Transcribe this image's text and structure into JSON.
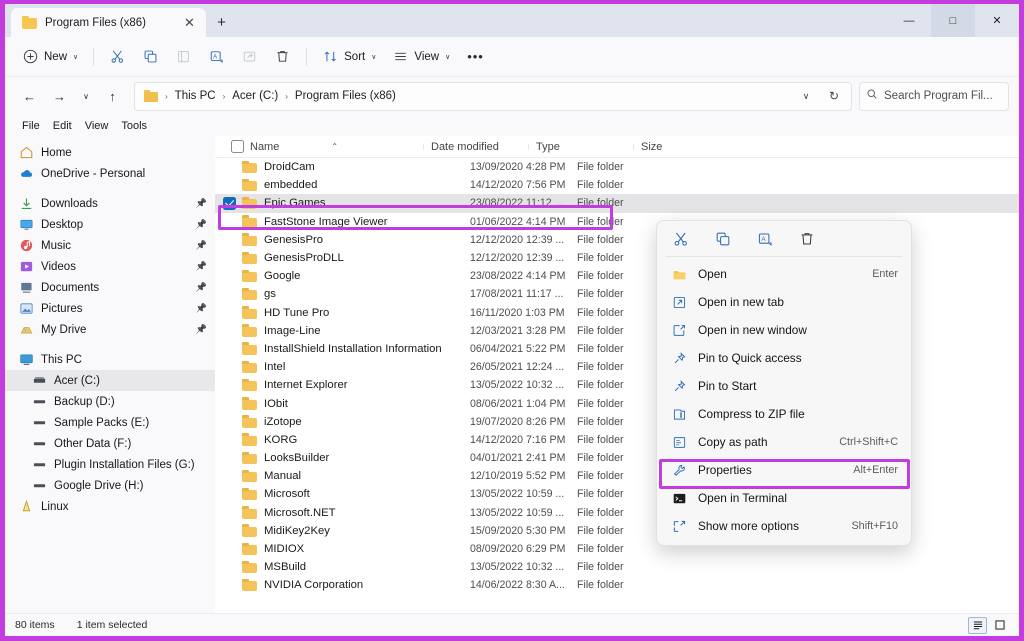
{
  "window": {
    "tab_title": "Program Files (x86)",
    "new_tab_label": "+",
    "close_tab_label": "✕",
    "minimize_label": "—",
    "maximize_label": "□",
    "close_label": "✕",
    "accent_purple": "#c23ce0"
  },
  "toolbar": {
    "new_label": "New",
    "new_chevron": "∨",
    "cut_icon": "scissors-icon",
    "copy_icon": "copy-icon",
    "paste_icon": "paste-icon",
    "rename_icon": "rename-icon",
    "share_icon": "share-icon",
    "delete_icon": "trash-icon",
    "sort_label": "Sort",
    "sort_chevron": "∨",
    "view_label": "View",
    "view_chevron": "∨",
    "more_label": "•••"
  },
  "address": {
    "back_label": "←",
    "forward_label": "→",
    "recent_label": "∨",
    "up_label": "↑",
    "crumbs": [
      "This PC",
      "Acer (C:)",
      "Program Files (x86)"
    ],
    "crumb_sep": "›",
    "dropdown_label": "∨",
    "refresh_label": "↻",
    "search_placeholder": "Search Program Fil...",
    "search_icon": "search-icon"
  },
  "menubar": {
    "items": [
      "File",
      "Edit",
      "View",
      "Tools"
    ]
  },
  "sidebar": {
    "items": [
      {
        "label": "Home",
        "icon": "home-icon",
        "pinned": false,
        "selected": false,
        "indent": false
      },
      {
        "label": "OneDrive - Personal",
        "icon": "cloud-icon",
        "pinned": false,
        "selected": false,
        "indent": false
      },
      {
        "separator": true
      },
      {
        "label": "Downloads",
        "icon": "download-icon",
        "pinned": true,
        "selected": false,
        "indent": false
      },
      {
        "label": "Desktop",
        "icon": "desktop-icon",
        "pinned": true,
        "selected": false,
        "indent": false
      },
      {
        "label": "Music",
        "icon": "music-icon",
        "pinned": true,
        "selected": false,
        "indent": false
      },
      {
        "label": "Videos",
        "icon": "video-icon",
        "pinned": true,
        "selected": false,
        "indent": false
      },
      {
        "label": "Documents",
        "icon": "documents-icon",
        "pinned": true,
        "selected": false,
        "indent": false
      },
      {
        "label": "Pictures",
        "icon": "pictures-icon",
        "pinned": true,
        "selected": false,
        "indent": false
      },
      {
        "label": "My Drive",
        "icon": "drive-icon",
        "pinned": true,
        "selected": false,
        "indent": false
      },
      {
        "separator": true
      },
      {
        "label": "This PC",
        "icon": "pc-icon",
        "pinned": false,
        "selected": false,
        "indent": false
      },
      {
        "label": "Acer (C:)",
        "icon": "harddrive-icon",
        "pinned": false,
        "selected": true,
        "indent": true
      },
      {
        "label": "Backup (D:)",
        "icon": "drive-bar-icon",
        "pinned": false,
        "selected": false,
        "indent": true
      },
      {
        "label": "Sample Packs (E:)",
        "icon": "drive-bar-icon",
        "pinned": false,
        "selected": false,
        "indent": true
      },
      {
        "label": "Other Data (F:)",
        "icon": "drive-bar-icon",
        "pinned": false,
        "selected": false,
        "indent": true
      },
      {
        "label": "Plugin Installation Files (G:)",
        "icon": "drive-bar-icon",
        "pinned": false,
        "selected": false,
        "indent": true
      },
      {
        "label": "Google Drive (H:)",
        "icon": "drive-bar-icon",
        "pinned": false,
        "selected": false,
        "indent": true
      },
      {
        "label": "Linux",
        "icon": "linux-icon",
        "pinned": false,
        "selected": false,
        "indent": false
      }
    ],
    "pin_icon": "pin-icon"
  },
  "filelist": {
    "columns": [
      "Name",
      "Date modified",
      "Type",
      "Size"
    ],
    "sort_indicator": "⌃",
    "select_all_checkbox": "checkbox-icon",
    "rows": [
      {
        "name": "DroidCam",
        "date": "13/09/2020 4:28 PM",
        "type": "File folder",
        "size": "",
        "selected": false,
        "checked": false
      },
      {
        "name": "embedded",
        "date": "14/12/2020 7:56 PM",
        "type": "File folder",
        "size": "",
        "selected": false,
        "checked": false
      },
      {
        "name": "Epic Games",
        "date": "23/08/2022 11:12 ...",
        "type": "File folder",
        "size": "",
        "selected": true,
        "checked": true
      },
      {
        "name": "FastStone Image Viewer",
        "date": "01/06/2022 4:14 PM",
        "type": "File folder",
        "size": "",
        "selected": false,
        "checked": false
      },
      {
        "name": "GenesisPro",
        "date": "12/12/2020 12:39 ...",
        "type": "File folder",
        "size": "",
        "selected": false,
        "checked": false
      },
      {
        "name": "GenesisProDLL",
        "date": "12/12/2020 12:39 ...",
        "type": "File folder",
        "size": "",
        "selected": false,
        "checked": false
      },
      {
        "name": "Google",
        "date": "23/08/2022 4:14 PM",
        "type": "File folder",
        "size": "",
        "selected": false,
        "checked": false
      },
      {
        "name": "gs",
        "date": "17/08/2021 11:17 ...",
        "type": "File folder",
        "size": "",
        "selected": false,
        "checked": false
      },
      {
        "name": "HD Tune Pro",
        "date": "16/11/2020 1:03 PM",
        "type": "File folder",
        "size": "",
        "selected": false,
        "checked": false
      },
      {
        "name": "Image-Line",
        "date": "12/03/2021 3:28 PM",
        "type": "File folder",
        "size": "",
        "selected": false,
        "checked": false
      },
      {
        "name": "InstallShield Installation Information",
        "date": "06/04/2021 5:22 PM",
        "type": "File folder",
        "size": "",
        "selected": false,
        "checked": false
      },
      {
        "name": "Intel",
        "date": "26/05/2021 12:24 ...",
        "type": "File folder",
        "size": "",
        "selected": false,
        "checked": false
      },
      {
        "name": "Internet Explorer",
        "date": "13/05/2022 10:32 ...",
        "type": "File folder",
        "size": "",
        "selected": false,
        "checked": false
      },
      {
        "name": "IObit",
        "date": "08/06/2021 1:04 PM",
        "type": "File folder",
        "size": "",
        "selected": false,
        "checked": false
      },
      {
        "name": "iZotope",
        "date": "19/07/2020 8:26 PM",
        "type": "File folder",
        "size": "",
        "selected": false,
        "checked": false
      },
      {
        "name": "KORG",
        "date": "14/12/2020 7:16 PM",
        "type": "File folder",
        "size": "",
        "selected": false,
        "checked": false
      },
      {
        "name": "LooksBuilder",
        "date": "04/01/2021 2:41 PM",
        "type": "File folder",
        "size": "",
        "selected": false,
        "checked": false
      },
      {
        "name": "Manual",
        "date": "12/10/2019 5:52 PM",
        "type": "File folder",
        "size": "",
        "selected": false,
        "checked": false
      },
      {
        "name": "Microsoft",
        "date": "13/05/2022 10:59 ...",
        "type": "File folder",
        "size": "",
        "selected": false,
        "checked": false
      },
      {
        "name": "Microsoft.NET",
        "date": "13/05/2022 10:59 ...",
        "type": "File folder",
        "size": "",
        "selected": false,
        "checked": false
      },
      {
        "name": "MidiKey2Key",
        "date": "15/09/2020 5:30 PM",
        "type": "File folder",
        "size": "",
        "selected": false,
        "checked": false
      },
      {
        "name": "MIDIOX",
        "date": "08/09/2020 6:29 PM",
        "type": "File folder",
        "size": "",
        "selected": false,
        "checked": false
      },
      {
        "name": "MSBuild",
        "date": "13/05/2022 10:32 ...",
        "type": "File folder",
        "size": "",
        "selected": false,
        "checked": false
      },
      {
        "name": "NVIDIA Corporation",
        "date": "14/06/2022 8:30 A...",
        "type": "File folder",
        "size": "",
        "selected": false,
        "checked": false
      }
    ]
  },
  "context_menu": {
    "toolbar_icons": [
      "cut-icon",
      "copy-icon",
      "rename-icon",
      "delete-icon"
    ],
    "items": [
      {
        "label": "Open",
        "accel": "Enter",
        "icon": "folder-icon",
        "highlighted": false
      },
      {
        "label": "Open in new tab",
        "accel": "",
        "icon": "new-tab-icon",
        "highlighted": false
      },
      {
        "label": "Open in new window",
        "accel": "",
        "icon": "new-window-icon",
        "highlighted": false
      },
      {
        "label": "Pin to Quick access",
        "accel": "",
        "icon": "pin-icon",
        "highlighted": false
      },
      {
        "label": "Pin to Start",
        "accel": "",
        "icon": "pin-icon",
        "highlighted": false
      },
      {
        "label": "Compress to ZIP file",
        "accel": "",
        "icon": "zip-icon",
        "highlighted": false
      },
      {
        "label": "Copy as path",
        "accel": "Ctrl+Shift+C",
        "icon": "copy-path-icon",
        "highlighted": false
      },
      {
        "label": "Properties",
        "accel": "Alt+Enter",
        "icon": "wrench-icon",
        "highlighted": true
      },
      {
        "label": "Open in Terminal",
        "accel": "",
        "icon": "terminal-icon",
        "highlighted": false
      },
      {
        "label": "Show more options",
        "accel": "Shift+F10",
        "icon": "more-options-icon",
        "highlighted": false
      }
    ]
  },
  "statusbar": {
    "item_count": "80 items",
    "selection_count": "1 item selected",
    "details_view_icon": "details-view-icon",
    "large_icons_view_icon": "large-icons-view-icon"
  }
}
